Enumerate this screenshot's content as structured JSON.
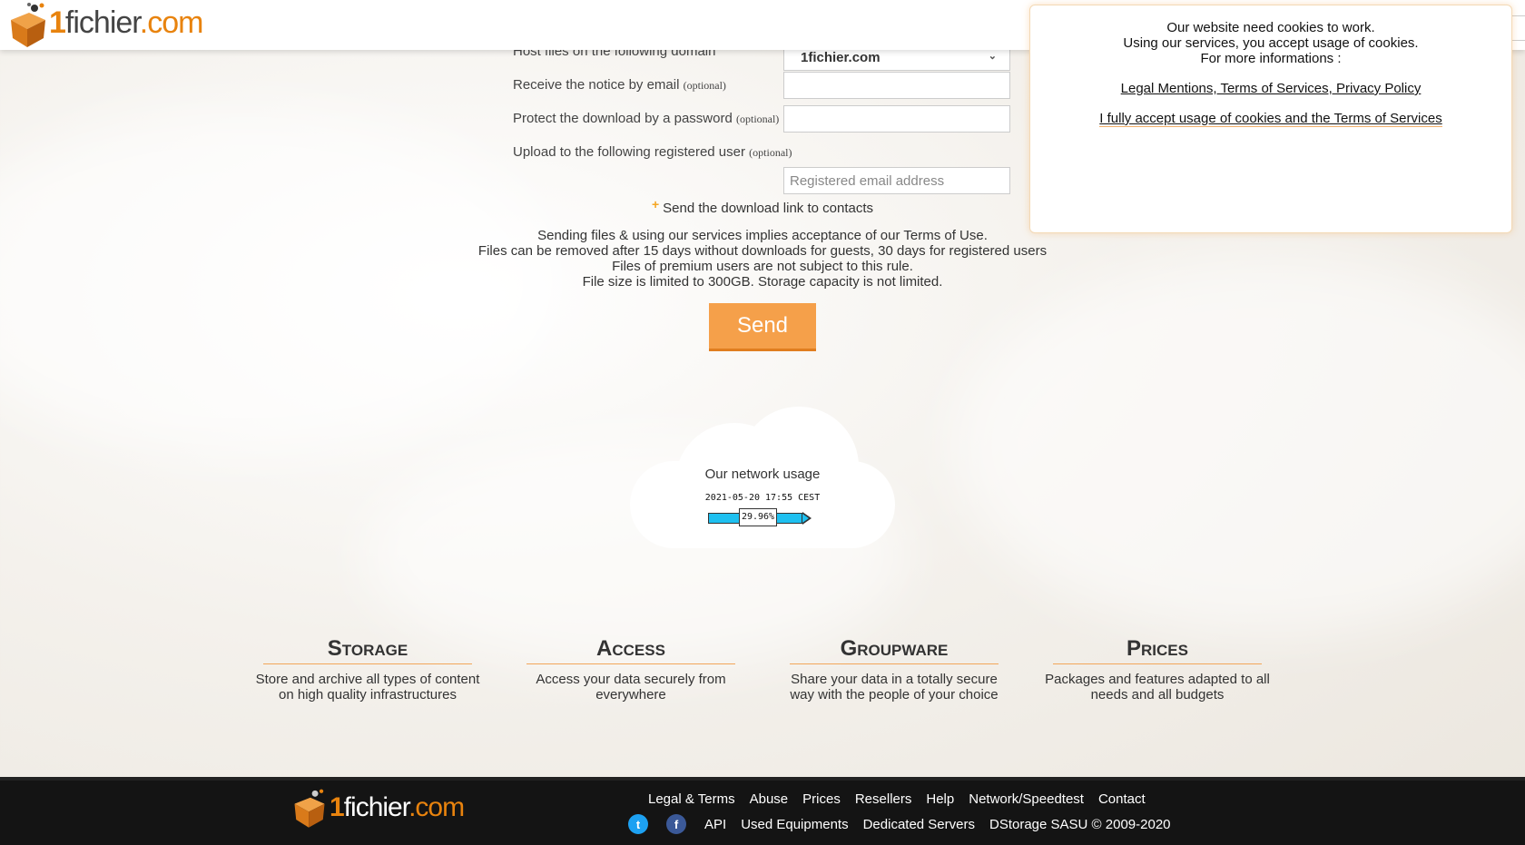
{
  "header": {
    "logo_one": "1",
    "logo_name": "fichier",
    "logo_tld": ".com"
  },
  "form": {
    "domain_label": "Host files on the following domain",
    "domain_value": "1fichier.com",
    "email_label": "Receive the notice by email",
    "email_optional": "(optional)",
    "password_label": "Protect the download by a password",
    "password_optional": "(optional)",
    "user_label": "Upload to the following registered user",
    "user_optional": "(optional)",
    "user_placeholder": "Registered email address",
    "contacts_plus": "+",
    "contacts_label": "Send the download link to contacts"
  },
  "notes": [
    "Sending files & using our services implies acceptance of our Terms of Use.",
    "Files can be removed after 15 days without downloads for guests, 30 days for registered users",
    "Files of premium users are not subject to this rule.",
    "File size is limited to 300GB. Storage capacity is not limited."
  ],
  "send_label": "Send",
  "network": {
    "title": "Our network usage",
    "date": "2021-05-20 17:55 CEST",
    "usage": "29.96%"
  },
  "features": [
    {
      "title": "Storage",
      "text": "Store and archive all types of content on high quality infrastructures"
    },
    {
      "title": "Access",
      "text": "Access your data securely from everywhere"
    },
    {
      "title": "Groupware",
      "text": "Share your data in a totally secure way with the people of your choice"
    },
    {
      "title": "Prices",
      "text": "Packages and features adapted to all needs and all budgets"
    }
  ],
  "cookie": {
    "line1": "Our website need cookies to work.",
    "line2": "Using our services, you accept usage of cookies.",
    "line3": "For more informations :",
    "legal_link": "Legal Mentions, Terms of Services, Privacy Policy",
    "accept_link": "I fully accept usage of cookies and the Terms of Services"
  },
  "footer": {
    "links_row1": [
      "Legal & Terms",
      "Abuse",
      "Prices",
      "Resellers",
      "Help",
      "Network/Speedtest",
      "Contact"
    ],
    "api": "API",
    "used_equipments": "Used Equipments",
    "dedicated_servers": "Dedicated Servers",
    "copyright": "DStorage SASU © 2009-2020"
  }
}
